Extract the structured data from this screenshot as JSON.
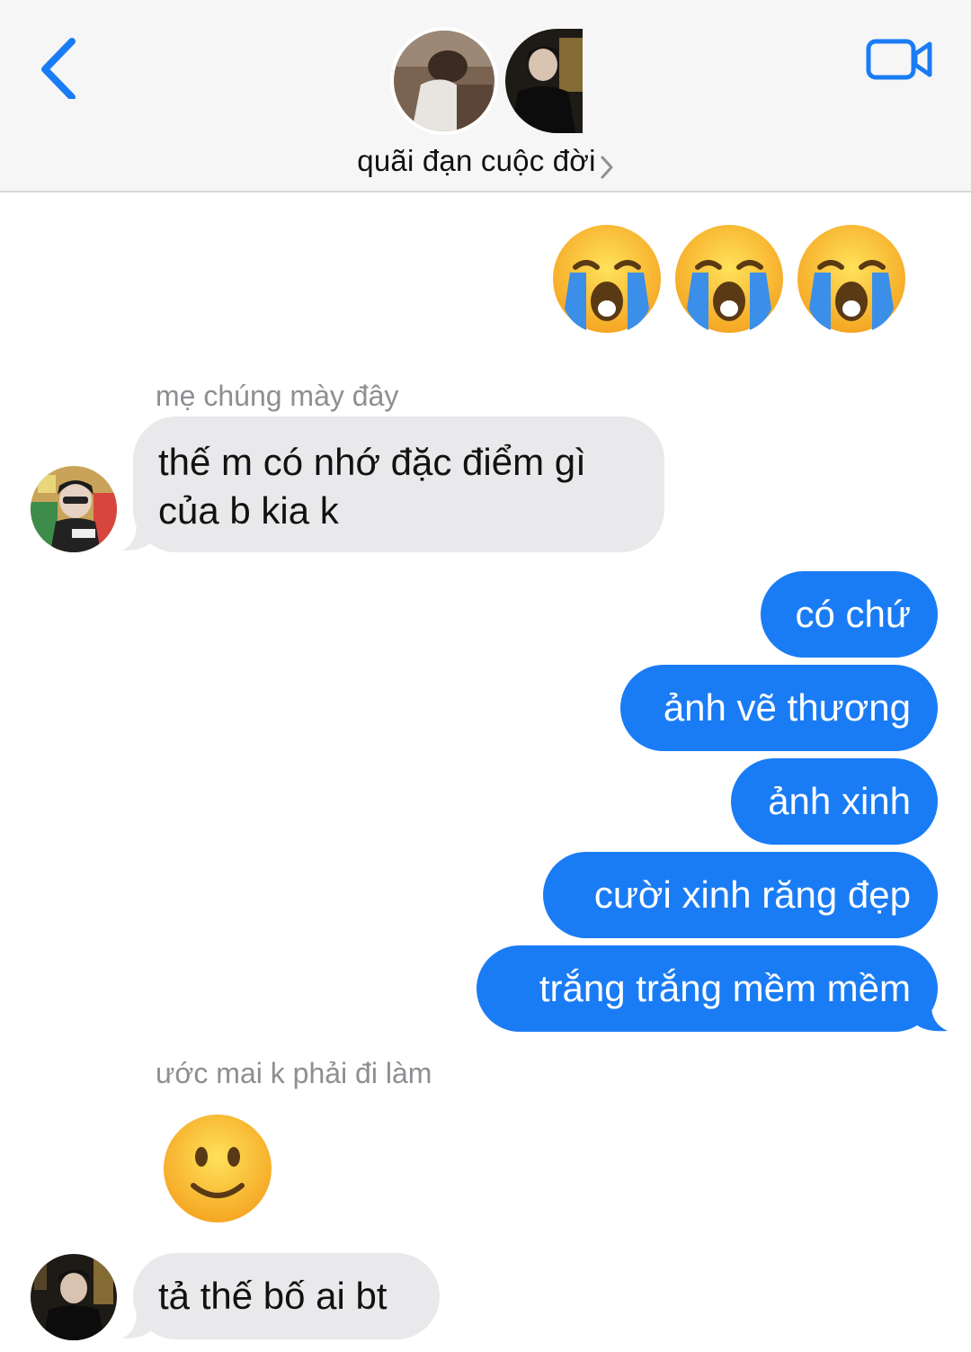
{
  "header": {
    "title": "quãi đạn cuộc đời",
    "back_icon": "chevron-left-icon",
    "video_icon": "video-camera-icon",
    "accent": "#1a7cf5"
  },
  "messages": {
    "top_emojis": [
      "😭",
      "😭",
      "😭"
    ],
    "sender1_name": "mẹ chúng mày đây",
    "in1_line1": "thế m có nhớ đặc điểm gì",
    "in1_line2": "của b kia k",
    "out": [
      "có chứ",
      "ảnh vẽ thương",
      "ảnh xinh",
      "cười xinh răng đẹp",
      "trắng trắng mềm mềm"
    ],
    "sender2_name": "ước mai k phải đi làm",
    "smile_emoji": "🙂",
    "in2": "tả thế bố ai bt"
  },
  "colors": {
    "incoming_bubble": "#e9e9eb",
    "outgoing_bubble": "#1a7cf5",
    "header_bg": "#f6f6f6"
  }
}
